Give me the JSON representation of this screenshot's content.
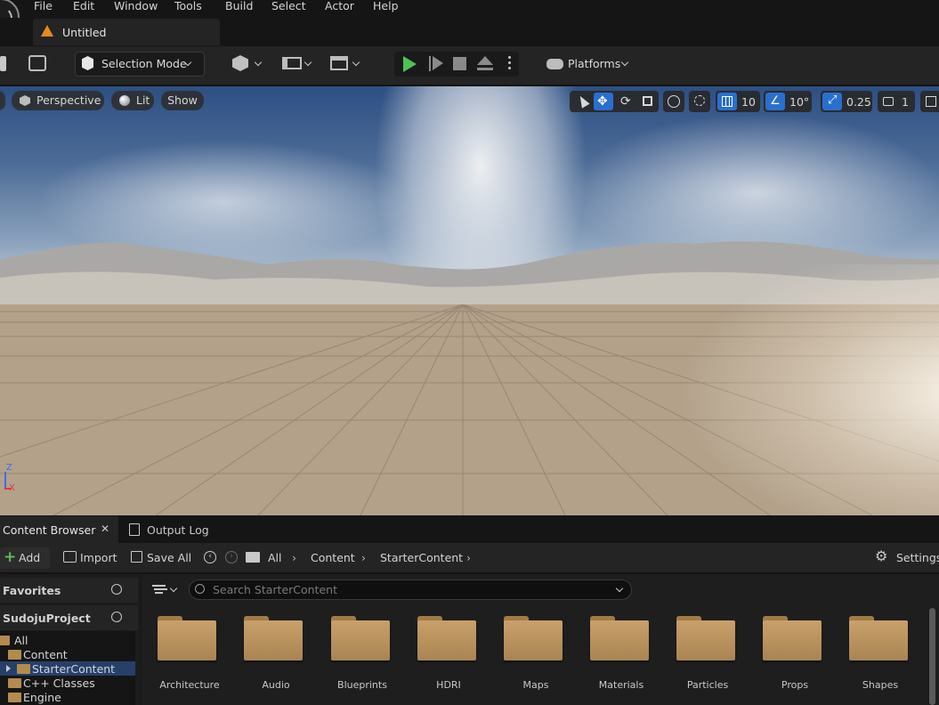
{
  "menu": [
    "File",
    "Edit",
    "Window",
    "Tools",
    "Build",
    "Select",
    "Actor",
    "Help"
  ],
  "level_tab": {
    "title": "Untitled"
  },
  "toolbar": {
    "selection_mode": "Selection Mode",
    "platforms": "Platforms"
  },
  "viewport": {
    "perspective": "Perspective",
    "lit": "Lit",
    "show": "Show",
    "grid_snap": "10",
    "rotation_snap": "10°",
    "scale_snap": "0.25",
    "camera_speed": "1",
    "axis_z": "Z",
    "axis_x": "X"
  },
  "bottom_tabs": {
    "content_browser": "Content Browser",
    "output_log": "Output Log"
  },
  "cb_toolbar": {
    "add": "Add",
    "import": "Import",
    "save_all": "Save All",
    "breadcrumb": [
      "All",
      "Content",
      "StarterContent"
    ],
    "settings": "Settings"
  },
  "sources": {
    "favorites": "Favorites",
    "project": "SudojuProject",
    "tree": [
      "All",
      "Content",
      "StarterContent",
      "C++ Classes",
      "Engine"
    ]
  },
  "search": {
    "placeholder": "Search StarterContent"
  },
  "folders": [
    "Architecture",
    "Audio",
    "Blueprints",
    "HDRI",
    "Maps",
    "Materials",
    "Particles",
    "Props",
    "Shapes"
  ]
}
